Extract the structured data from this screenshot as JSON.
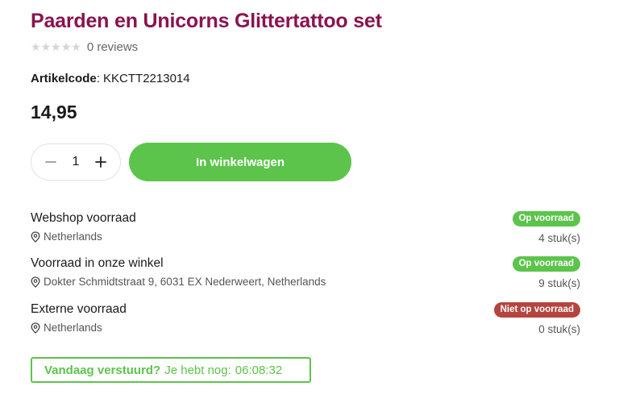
{
  "product": {
    "title": "Paarden en Unicorns Glittertattoo set",
    "reviews_text": "0 reviews",
    "rating": 0,
    "rating_max": 5,
    "sku_label": "Artikelcode",
    "sku_separator": ":",
    "sku_value": "KKCTT2213014",
    "price": "14,95"
  },
  "purchase": {
    "quantity": "1",
    "add_to_cart_label": "In winkelwagen"
  },
  "stock": [
    {
      "location": "Webshop voorraad",
      "address": "Netherlands",
      "status": "Op voorraad",
      "status_color": "#5cc44b",
      "count": "4 stuk(s)"
    },
    {
      "location": "Voorraad in onze winkel",
      "address": "Dokter Schmidtstraat 9, 6031 EX Nederweert, Netherlands",
      "status": "Op voorraad",
      "status_color": "#5cc44b",
      "count": "9 stuk(s)"
    },
    {
      "location": "Externe voorraad",
      "address": "Netherlands",
      "status": "Niet op voorraad",
      "status_color": "#b5443f",
      "count": "0 stuk(s)"
    }
  ],
  "shipping": {
    "question": "Vandaag verstuurd?",
    "prefix": "Je hebt nog:",
    "countdown": "06:08:32"
  },
  "colors": {
    "title": "#8a1350",
    "accent": "#5cc44b",
    "danger": "#b5443f"
  }
}
